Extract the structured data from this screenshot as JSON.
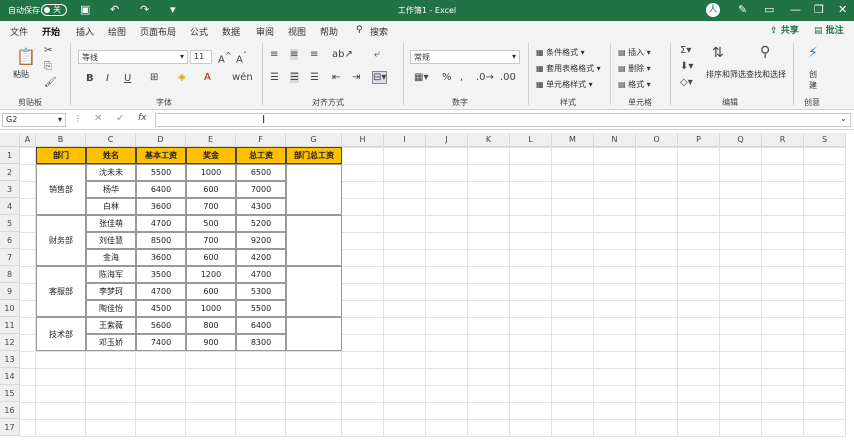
{
  "titlebar": {
    "autosave": "自动保存",
    "toggle": "关",
    "doc": "工作簿1 - Excel",
    "avatar": "人"
  },
  "menu": [
    "文件",
    "开始",
    "插入",
    "绘图",
    "页面布局",
    "公式",
    "数据",
    "审阅",
    "视图",
    "帮助"
  ],
  "search": "搜索",
  "share": "共享",
  "comment": "批注",
  "ribbon": {
    "paste": "粘贴",
    "clipboard": "剪贴板",
    "font_name": "等线",
    "font_size": "11",
    "font_group": "字体",
    "align_group": "对齐方式",
    "number_format": "常规",
    "number_group": "数字",
    "cond_format": "条件格式",
    "table_format": "套用表格格式",
    "cell_style": "单元格样式",
    "style_group": "样式",
    "insert": "插入",
    "delete": "删除",
    "format": "格式",
    "cells_group": "单元格",
    "sort_filter": "排序和筛选",
    "find_select": "查找和选择",
    "edit_group": "编辑",
    "create": "创\n建",
    "create_group": "创意"
  },
  "namebox": "G2",
  "fx": "fx",
  "columns": [
    "A",
    "B",
    "C",
    "D",
    "E",
    "F",
    "G",
    "H",
    "I",
    "J",
    "K",
    "L",
    "M",
    "N",
    "O",
    "P",
    "Q",
    "R",
    "S"
  ],
  "rows": [
    "1",
    "2",
    "3",
    "4",
    "5",
    "6",
    "7",
    "8",
    "9",
    "10",
    "11",
    "12",
    "13",
    "14",
    "15",
    "16",
    "17"
  ],
  "table": {
    "headers": [
      "部门",
      "姓名",
      "基本工资",
      "奖金",
      "总工资",
      "部门总工资"
    ],
    "departments": [
      "销售部",
      "财务部",
      "客服部",
      "技术部"
    ],
    "rows": [
      [
        "沈未未",
        "5500",
        "1000",
        "6500"
      ],
      [
        "杨华",
        "6400",
        "600",
        "7000"
      ],
      [
        "白林",
        "3600",
        "700",
        "4300"
      ],
      [
        "张佳萌",
        "4700",
        "500",
        "5200"
      ],
      [
        "刘佳慧",
        "8500",
        "700",
        "9200"
      ],
      [
        "金海",
        "3600",
        "600",
        "4200"
      ],
      [
        "陈海军",
        "3500",
        "1200",
        "4700"
      ],
      [
        "李梦珂",
        "4700",
        "600",
        "5300"
      ],
      [
        "陶佳怡",
        "4500",
        "1000",
        "5500"
      ],
      [
        "王紫薇",
        "5600",
        "800",
        "6400"
      ],
      [
        "邓玉娇",
        "7400",
        "900",
        "8300"
      ]
    ]
  }
}
